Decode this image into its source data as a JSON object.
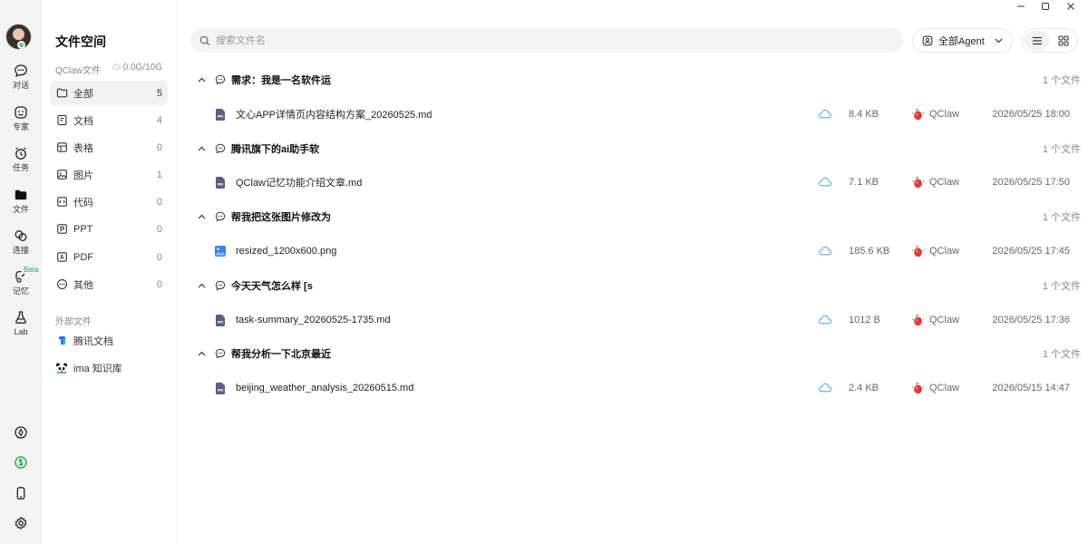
{
  "window": {
    "controls": [
      "minimize",
      "maximize",
      "close"
    ]
  },
  "rail": {
    "items": [
      {
        "label": "对话",
        "icon": "chat-icon"
      },
      {
        "label": "专家",
        "icon": "expert-icon"
      },
      {
        "label": "任务",
        "icon": "alarm-clock-icon"
      },
      {
        "label": "文件",
        "icon": "folder-icon"
      },
      {
        "label": "连接",
        "icon": "link-icon"
      },
      {
        "label": "记忆",
        "icon": "memory-icon",
        "badge": "Beta"
      },
      {
        "label": "Lab",
        "icon": "flask-icon"
      }
    ],
    "bottom_icons": [
      "compass-icon",
      "coin-icon",
      "phone-icon",
      "settings-icon"
    ]
  },
  "sidebar": {
    "title": "文件空间",
    "quota_label": "QClaw文件",
    "quota_value": "0.0G/10G",
    "items": [
      {
        "label": "全部",
        "count": "5",
        "icon": "folder-icon",
        "active": true
      },
      {
        "label": "文档",
        "count": "4",
        "icon": "document-icon"
      },
      {
        "label": "表格",
        "count": "0",
        "icon": "table-icon"
      },
      {
        "label": "图片",
        "count": "1",
        "icon": "image-icon"
      },
      {
        "label": "代码",
        "count": "0",
        "icon": "code-icon"
      },
      {
        "label": "PPT",
        "count": "0",
        "icon": "ppt-icon"
      },
      {
        "label": "PDF",
        "count": "0",
        "icon": "pdf-icon"
      },
      {
        "label": "其他",
        "count": "0",
        "icon": "more-icon"
      }
    ],
    "external_section": "外部文件",
    "external_items": [
      {
        "label": "腾讯文档",
        "icon": "tencent-docs-icon"
      },
      {
        "label": "ima 知识库",
        "icon": "ima-panda-icon"
      }
    ]
  },
  "toolbar": {
    "search_placeholder": "搜索文件名",
    "agent_filter": "全部Agent"
  },
  "groups": [
    {
      "title": "需求：我是一名软件运",
      "count": "1 个文件",
      "files": [
        {
          "name": "文心APP详情页内容结构方案_20260525.md",
          "type": "md",
          "size": "8.4 KB",
          "agent": "QClaw",
          "date": "2026/05/25 18:00"
        }
      ]
    },
    {
      "title": "腾讯旗下的ai助手软",
      "count": "1 个文件",
      "files": [
        {
          "name": "QClaw记忆功能介绍文章.md",
          "type": "md",
          "size": "7.1 KB",
          "agent": "QClaw",
          "date": "2026/05/25 17:50"
        }
      ]
    },
    {
      "title": "帮我把这张图片修改为",
      "count": "1 个文件",
      "files": [
        {
          "name": "resized_1200x600.png",
          "type": "image",
          "size": "185.6 KB",
          "agent": "QClaw",
          "date": "2026/05/25 17:45"
        }
      ]
    },
    {
      "title": "今天天气怎么样 [s",
      "count": "1 个文件",
      "files": [
        {
          "name": "task-summary_20260525-1735.md",
          "type": "md",
          "size": "1012 B",
          "agent": "QClaw",
          "date": "2026/05/25 17:36"
        }
      ]
    },
    {
      "title": "帮我分析一下北京最近",
      "count": "1 个文件",
      "files": [
        {
          "name": "beijing_weather_analysis_20260515.md",
          "type": "md",
          "size": "2.4 KB",
          "agent": "QClaw",
          "date": "2026/05/15 14:47"
        }
      ]
    }
  ],
  "colors": {
    "rail_bg": "#f3f3f4",
    "active_item_bg": "#f1f1f2",
    "md_icon": "#5a5f7d",
    "image_icon": "#3b82f6",
    "cloud_icon": "#5aa9e6",
    "beta_badge": "#2fa84f",
    "agent_logo": "#e23a3a"
  }
}
